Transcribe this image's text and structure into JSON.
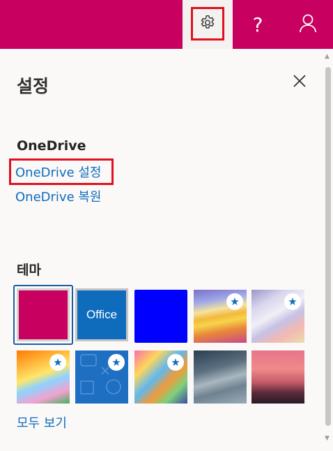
{
  "topbar": {
    "background": "#c8005f",
    "icons": [
      "gear-icon",
      "help-icon",
      "user-icon"
    ],
    "help_glyph": "?"
  },
  "panel": {
    "title": "설정",
    "close_icon": "close-icon"
  },
  "onedrive": {
    "heading": "OneDrive",
    "links": [
      "OneDrive 설정",
      "OneDrive 복원"
    ]
  },
  "themes": {
    "heading": "테마",
    "tiles": [
      {
        "name": "magenta",
        "selected": true,
        "premium": false
      },
      {
        "name": "office",
        "label": "Office",
        "selected": false,
        "premium": false
      },
      {
        "name": "blue",
        "selected": false,
        "premium": false
      },
      {
        "name": "rainbow",
        "selected": false,
        "premium": true
      },
      {
        "name": "silver-waves",
        "selected": false,
        "premium": true
      },
      {
        "name": "cartoon",
        "selected": false,
        "premium": true
      },
      {
        "name": "icons-blue",
        "selected": false,
        "premium": true
      },
      {
        "name": "colorful-map",
        "selected": false,
        "premium": true
      },
      {
        "name": "mountain-clouds",
        "selected": false,
        "premium": false
      },
      {
        "name": "palm-sunset",
        "selected": false,
        "premium": false
      }
    ],
    "see_all": "모두 보기"
  },
  "colors": {
    "accent": "#c8005f",
    "link": "#0f6cbd",
    "highlight": "#e0101e",
    "selected_ring": "#1b5ea3"
  }
}
